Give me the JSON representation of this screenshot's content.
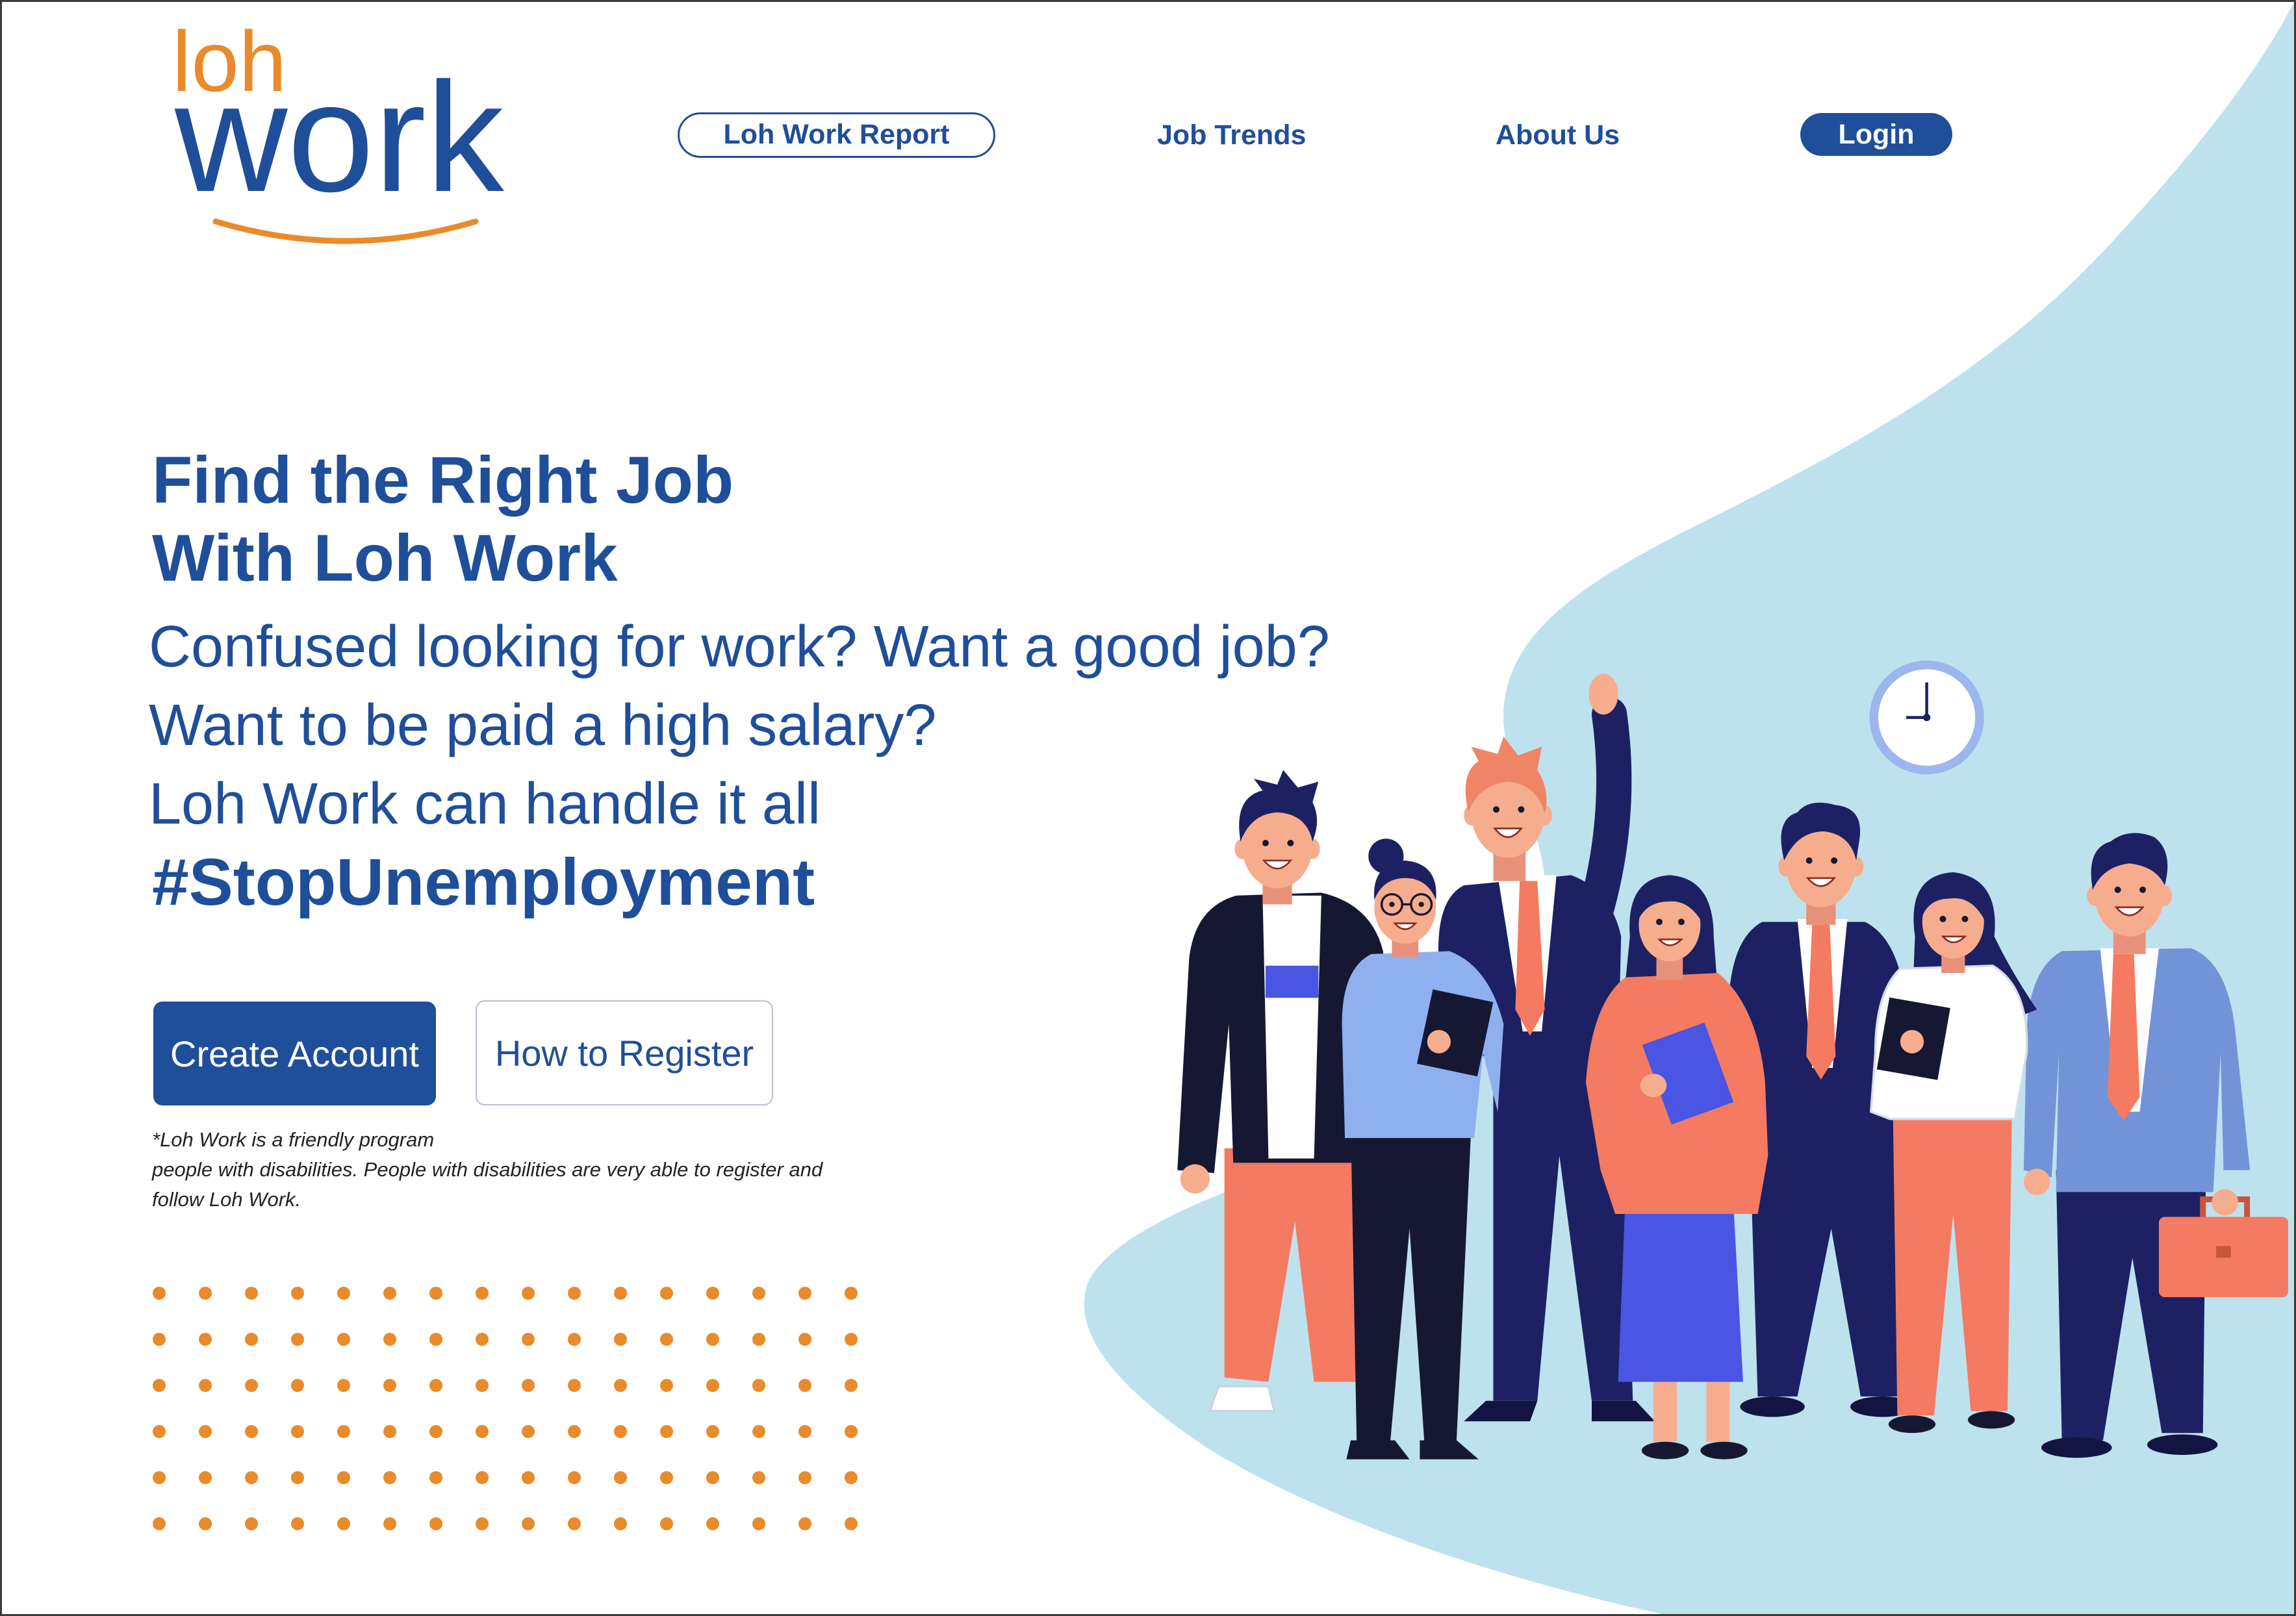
{
  "logo": {
    "top": "loh",
    "bottom": "work"
  },
  "nav": {
    "report": "Loh Work Report",
    "trends": "Job Trends",
    "about": "About Us",
    "login": "Login"
  },
  "hero": {
    "title_line1": "Find the Right Job",
    "title_line2": "With Loh Work",
    "lines": [
      "Confused looking for work? Want a good job?",
      "Want to be paid a high salary?",
      "Loh Work can handle it all"
    ],
    "hashtag": "#StopUnemployment"
  },
  "actions": {
    "create": "Create Account",
    "register": "How to Register"
  },
  "footnote": [
    "*Loh Work is a friendly program",
    "people with disabilities. People with disabilities are very able to register and",
    "follow Loh Work."
  ],
  "icons": {
    "clock": "clock-icon",
    "briefcase": "briefcase-icon"
  },
  "colors": {
    "brand_blue": "#1f4e9a",
    "accent_orange": "#e98a2b",
    "wave_blue": "#bde2ee"
  }
}
